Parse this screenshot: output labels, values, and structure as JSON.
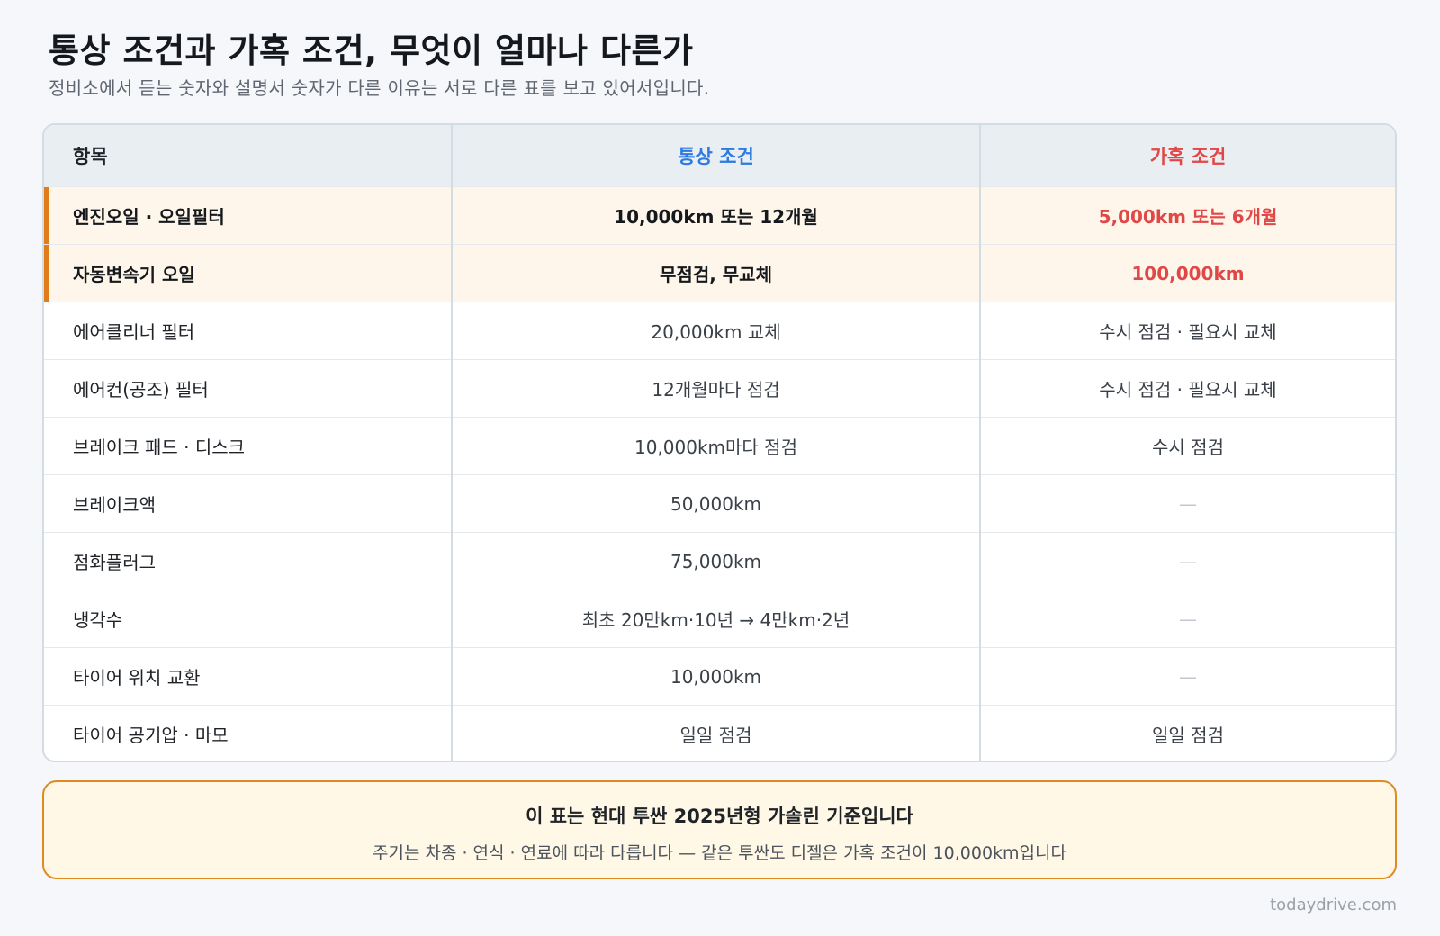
{
  "header": {
    "title": "통상 조건과 가혹 조건, 무엇이 얼마나 다른가",
    "subtitle": "정비소에서 듣는 숫자와 설명서 숫자가 다른 이유는 서로 다른 표를 보고 있어서입니다."
  },
  "table": {
    "columns": {
      "item": "항목",
      "normal": "통상 조건",
      "severe": "가혹 조건"
    },
    "rows": [
      {
        "item": "엔진오일 · 오일필터",
        "normal": "10,000km 또는 12개월",
        "severe": "5,000km 또는 6개월",
        "highlight": true
      },
      {
        "item": "자동변속기 오일",
        "normal": "무점검, 무교체",
        "severe": "100,000km",
        "highlight": true
      },
      {
        "item": "에어클리너 필터",
        "normal": "20,000km 교체",
        "severe": "수시 점검 · 필요시 교체",
        "highlight": false
      },
      {
        "item": "에어컨(공조) 필터",
        "normal": "12개월마다 점검",
        "severe": "수시 점검 · 필요시 교체",
        "highlight": false
      },
      {
        "item": "브레이크 패드 · 디스크",
        "normal": "10,000km마다 점검",
        "severe": "수시 점검",
        "highlight": false
      },
      {
        "item": "브레이크액",
        "normal": "50,000km",
        "severe": "—",
        "highlight": false
      },
      {
        "item": "점화플러그",
        "normal": "75,000km",
        "severe": "—",
        "highlight": false
      },
      {
        "item": "냉각수",
        "normal": "최초 20만km·10년 → 4만km·2년",
        "severe": "—",
        "highlight": false
      },
      {
        "item": "타이어 위치 교환",
        "normal": "10,000km",
        "severe": "—",
        "highlight": false
      },
      {
        "item": "타이어 공기압 · 마모",
        "normal": "일일 점검",
        "severe": "일일 점검",
        "highlight": false
      }
    ]
  },
  "notice": {
    "title": "이 표는 현대 투싼 2025년형 가솔린 기준입니다",
    "text": "주기는 차종 · 연식 · 연료에 따라 다릅니다 — 같은 투싼도 디젤은 가혹 조건이 10,000km입니다"
  },
  "footer": {
    "source": "todaydrive.com"
  },
  "colors": {
    "normal_accent": "#2d7be0",
    "severe_accent": "#e04848",
    "highlight_bar": "#e07d1a",
    "notice_border": "#e08a1f"
  }
}
